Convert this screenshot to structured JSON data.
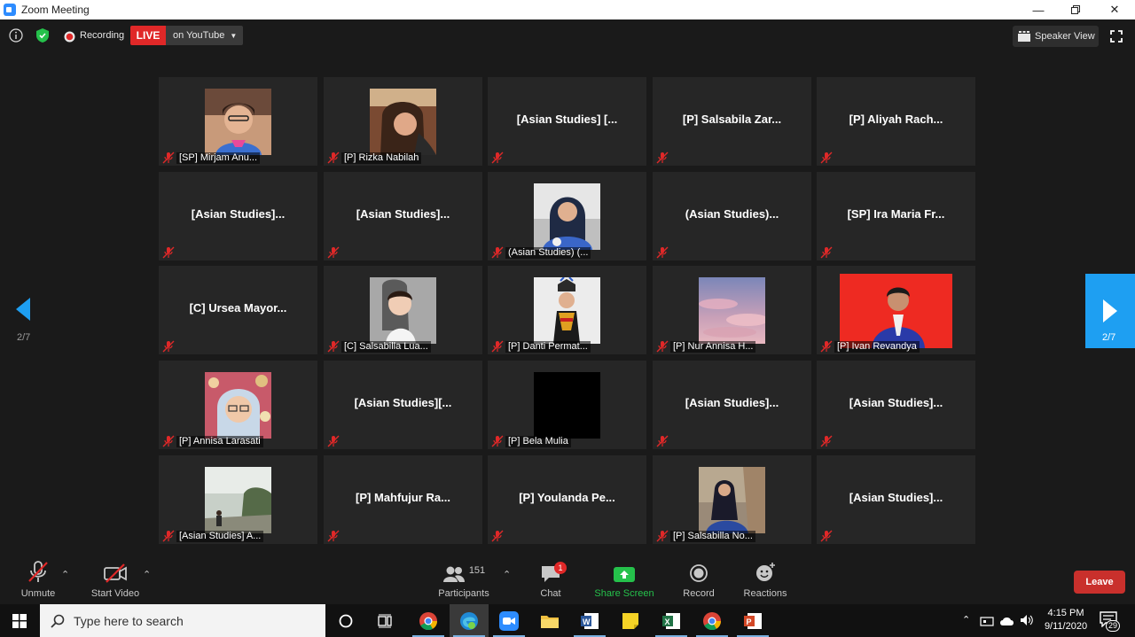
{
  "window": {
    "title": "Zoom Meeting"
  },
  "topbar": {
    "recording_label": "Recording",
    "live_label": "LIVE",
    "stream_label": "on YouTube",
    "view_label": "Speaker View"
  },
  "gallery": {
    "page_left": "2/7",
    "page_right": "2/7",
    "tiles": [
      {
        "name": "[SP] Mirjam Anu...",
        "label": "[SP] Mirjam Anu..."
      },
      {
        "name": "[P] Rizka Nabilah",
        "label": "[P] Rizka Nabilah"
      },
      {
        "name": "[Asian Studies] [...",
        "label": ""
      },
      {
        "name": "[P] Salsabila Zar...",
        "label": ""
      },
      {
        "name": "[P] Aliyah Rach...",
        "label": ""
      },
      {
        "name": "[Asian Studies]...",
        "label": ""
      },
      {
        "name": "[Asian Studies]...",
        "label": ""
      },
      {
        "name": "(Asian Studies) (...",
        "label": "(Asian Studies) (..."
      },
      {
        "name": "(Asian Studies)...",
        "label": ""
      },
      {
        "name": "[SP] Ira Maria Fr...",
        "label": ""
      },
      {
        "name": "[C] Ursea Mayor...",
        "label": ""
      },
      {
        "name": "[C] Salsabilla Lua...",
        "label": "[C] Salsabilla Lua..."
      },
      {
        "name": "[P] Danti Permat...",
        "label": "[P] Danti Permat..."
      },
      {
        "name": "[P] Nur Annisa H...",
        "label": "[P] Nur Annisa H..."
      },
      {
        "name": "[P] Ivan Revandya",
        "label": "[P] Ivan Revandya"
      },
      {
        "name": "[P] Annisa Larasati",
        "label": "[P] Annisa Larasati"
      },
      {
        "name": "[Asian Studies][...",
        "label": ""
      },
      {
        "name": "[P] Bela Mulia",
        "label": "[P] Bela Mulia"
      },
      {
        "name": "[Asian Studies]...",
        "label": ""
      },
      {
        "name": "[Asian Studies]...",
        "label": ""
      },
      {
        "name": "[Asian Studies] A...",
        "label": "[Asian Studies] A..."
      },
      {
        "name": "[P] Mahfujur Ra...",
        "label": ""
      },
      {
        "name": "[P] Youlanda Pe...",
        "label": ""
      },
      {
        "name": "[P] Salsabilla No...",
        "label": "[P] Salsabilla No..."
      },
      {
        "name": "[Asian Studies]...",
        "label": ""
      }
    ]
  },
  "toolbar": {
    "unmute": "Unmute",
    "start_video": "Start Video",
    "participants": "Participants",
    "participant_count": "151",
    "chat": "Chat",
    "chat_badge": "1",
    "share": "Share Screen",
    "record": "Record",
    "reactions": "Reactions",
    "leave": "Leave"
  },
  "taskbar": {
    "search_placeholder": "Type here to search",
    "time": "4:15 PM",
    "date": "9/11/2020",
    "notif_count": "29"
  },
  "colors": {
    "live": "#e02828",
    "share_green": "#25c14b",
    "leave_red": "#c9302c",
    "panel_blue": "#1e9ff2"
  }
}
